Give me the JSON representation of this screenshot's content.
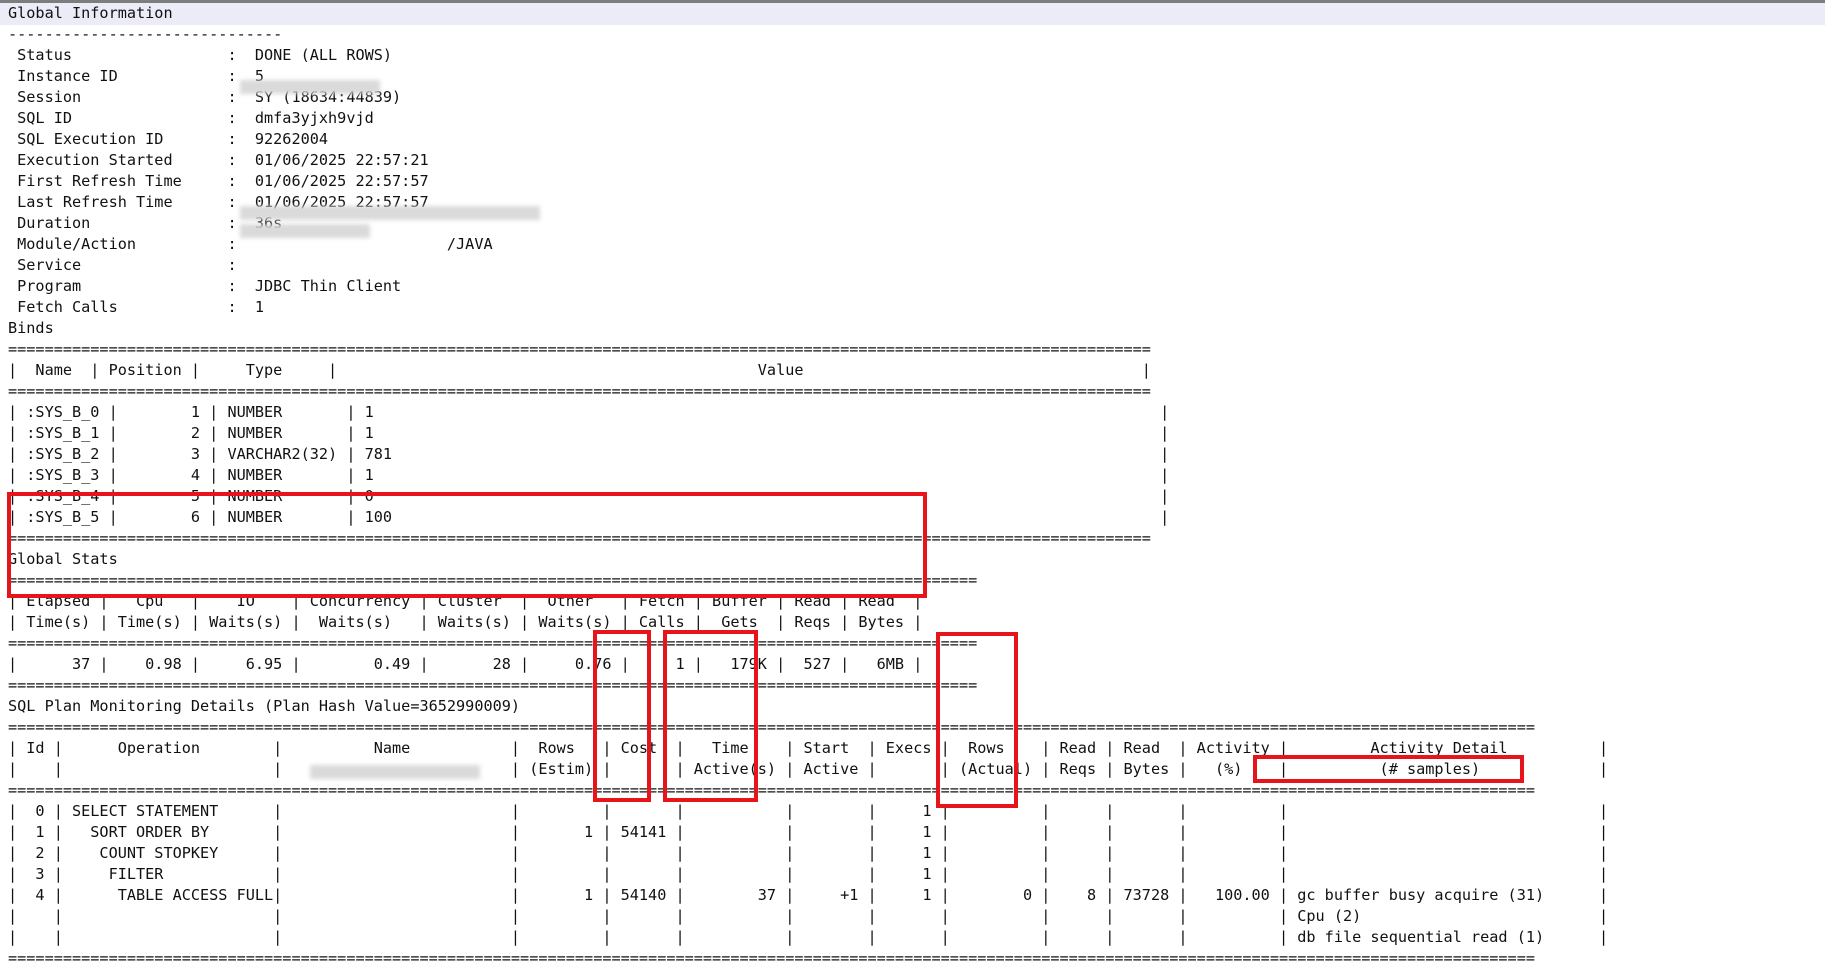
{
  "report_lines": [
    "Global Information",
    "------------------------------",
    " Status                 :  DONE (ALL ROWS)",
    " Instance ID            :  5",
    " Session                :  SY (18634:44839)",
    " SQL ID                 :  dmfa3yjxh9vjd",
    " SQL Execution ID       :  92262004",
    " Execution Started      :  01/06/2025 22:57:21",
    " First Refresh Time     :  01/06/2025 22:57:57",
    " Last Refresh Time      :  01/06/2025 22:57:57",
    " Duration               :  36s",
    " Module/Action          :                       /JAVA",
    " Service                :  ",
    " Program                :  JDBC Thin Client",
    " Fetch Calls            :  1",
    "Binds",
    "=============================================================================================================================",
    "|  Name  | Position |     Type     |                                              Value                                     |",
    "=============================================================================================================================",
    "| :SYS_B_0 |        1 | NUMBER       | 1                                                                                      |",
    "| :SYS_B_1 |        2 | NUMBER       | 1                                                                                      |",
    "| :SYS_B_2 |        3 | VARCHAR2(32) | 781                                                                                    |",
    "| :SYS_B_3 |        4 | NUMBER       | 1                                                                                      |",
    "| :SYS_B_4 |        5 | NUMBER       | 0                                                                                      |",
    "| :SYS_B_5 |        6 | NUMBER       | 100                                                                                    |",
    "=============================================================================================================================",
    "Global Stats",
    "==========================================================================================================",
    "| Elapsed |   Cpu   |    IO    | Concurrency | Cluster  |  Other   | Fetch | Buffer | Read | Read  |",
    "| Time(s) | Time(s) | Waits(s) |  Waits(s)   | Waits(s) | Waits(s) | Calls |  Gets  | Reqs | Bytes |",
    "==========================================================================================================",
    "|      37 |    0.98 |     6.95 |        0.49 |       28 |     0.76 |     1 |   179K |  527 |   6MB |",
    "==========================================================================================================",
    "SQL Plan Monitoring Details (Plan Hash Value=3652990009)",
    "=======================================================================================================================================================================",
    "| Id |      Operation        |          Name           |  Rows   | Cost  |   Time    | Start  | Execs |  Rows    | Read | Read  | Activity |         Activity Detail          |",
    "|    |                       |                         | (Estim) |       | Active(s) | Active |       | (Actual) | Reqs | Bytes |   (%)    |          (# samples)             |",
    "=======================================================================================================================================================================",
    "|  0 | SELECT STATEMENT      |                         |         |       |           |        |     1 |          |      |       |          |                                  |",
    "|  1 |   SORT ORDER BY       |                         |       1 | 54141 |           |        |     1 |          |      |       |          |                                  |",
    "|  2 |    COUNT STOPKEY      |                         |         |       |           |        |     1 |          |      |       |          |                                  |",
    "|  3 |     FILTER            |                         |         |       |           |        |     1 |          |      |       |          |                                  |",
    "|  4 |      TABLE ACCESS FULL|                         |       1 | 54140 |        37 |     +1 |     1 |        0 |    8 | 73728 |   100.00 | gc buffer busy acquire (31)      |",
    "|    |                       |                         |         |       |           |        |       |          |      |       |          | Cpu (2)                          |",
    "|    |                       |                         |         |       |           |        |       |          |      |       |          | db file sequential read (1)      |",
    "======================================================================================================================================================================="
  ],
  "highlight_color": "#e8141b"
}
